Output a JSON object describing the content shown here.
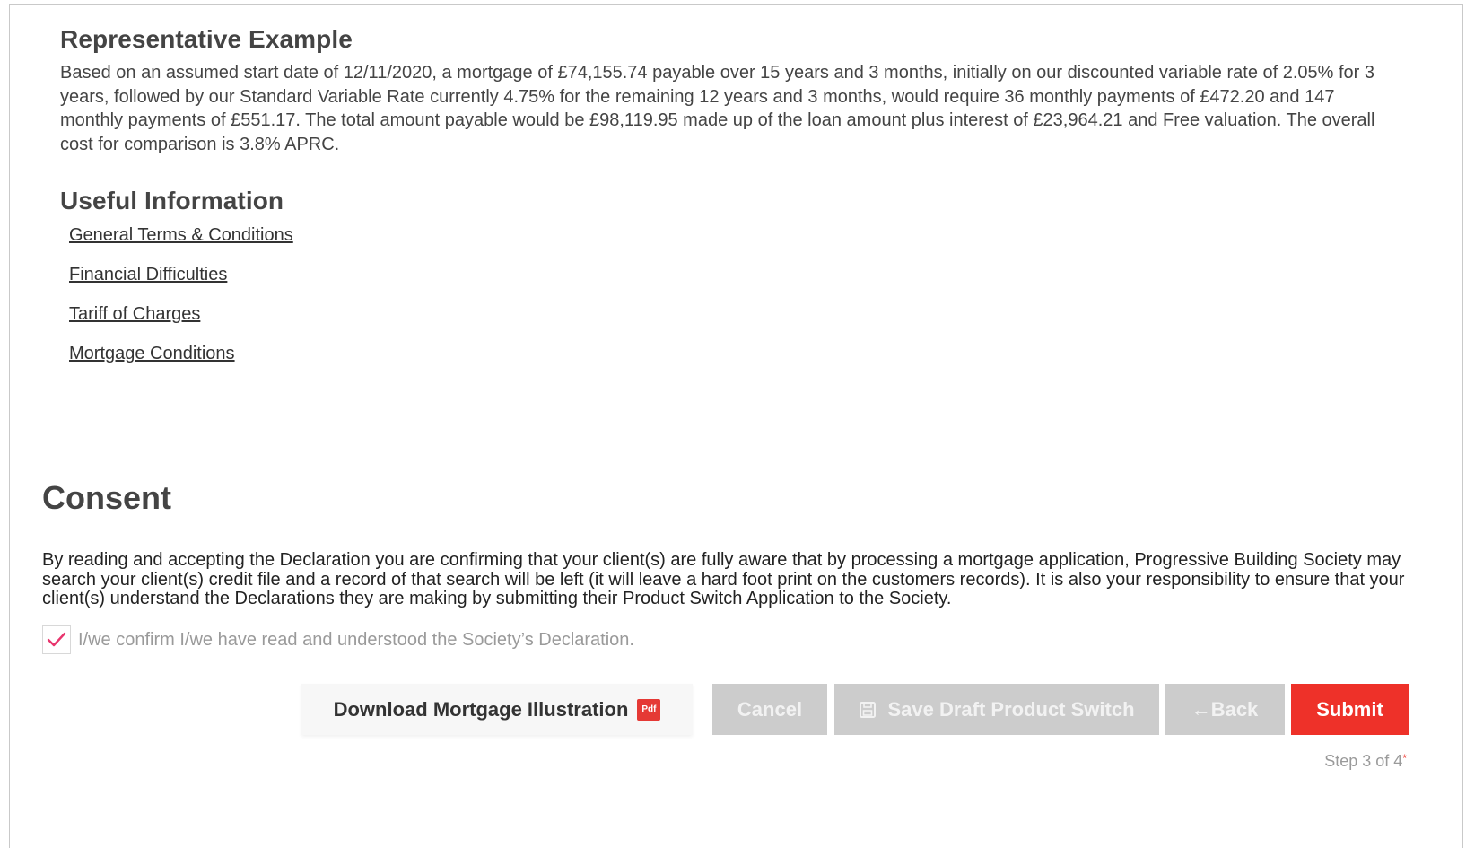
{
  "representative_example": {
    "title": "Representative Example",
    "text": "Based on an assumed start date of 12/11/2020, a mortgage of £74,155.74 payable over 15 years and 3 months, initially on our discounted variable rate of 2.05% for 3 years, followed by our Standard Variable Rate currently 4.75% for the remaining 12 years and 3 months, would require 36 monthly payments of £472.20 and 147 monthly payments of £551.17. The total amount payable would be £98,119.95 made up of the loan amount plus interest of £23,964.21 and Free valuation. The overall cost for comparison is 3.8% APRC."
  },
  "useful_information": {
    "title": "Useful Information",
    "links": [
      "General Terms & Conditions",
      "Financial Difficulties",
      "Tariff of Charges",
      "Mortgage Conditions"
    ]
  },
  "consent": {
    "title": "Consent",
    "text": "By reading and accepting the Declaration you are confirming that your client(s) are fully aware that by processing a mortgage application, Progressive Building Society may search your client(s) credit file and a record of that search will be left (it will leave a hard foot print on the customers records). It is also your responsibility to ensure that your client(s) understand the Declarations they are making by submitting their Product Switch Application to the Society.",
    "confirm_label": "I/we confirm I/we have read and understood the Society’s Declaration.",
    "confirm_checked": true
  },
  "actions": {
    "download_label": "Download Mortgage Illustration",
    "pdf_badge": "Pdf",
    "cancel_label": "Cancel",
    "save_label": "Save Draft Product Switch",
    "back_label": "←Back",
    "submit_label": "Submit"
  },
  "step": {
    "text": "Step 3 of 4",
    "marker": "*"
  },
  "colors": {
    "accent_red": "#ee3129",
    "disabled_grey": "#cccccc",
    "check_pink": "#e8356d"
  },
  "icons": [
    "checkmark-icon",
    "pdf-icon",
    "save-icon"
  ]
}
